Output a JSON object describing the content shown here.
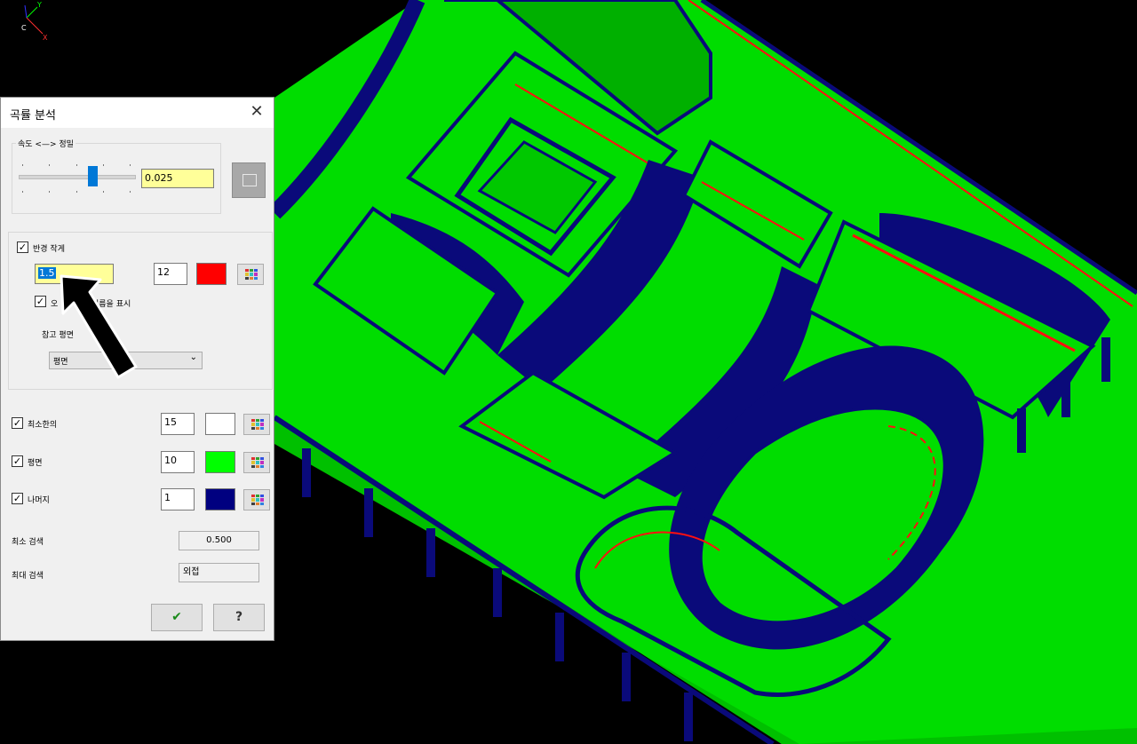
{
  "dialog": {
    "title": "곡률 분석",
    "close_glyph": "✕",
    "slider_group": {
      "legend": "속도 <—> 정밀",
      "value": "0.025",
      "position": 0.6
    },
    "radius_section": {
      "checkbox_label": "반경 작게",
      "checked": true,
      "radius_value": "1.5",
      "count_value": "12",
      "color": "#ff0000",
      "sub_checkbox_label_visible_start": "오",
      "sub_checkbox_label_visible_end": "지름을 표시",
      "ref_plane_label": "참고 평면",
      "ref_plane_selected": "평면"
    },
    "rows": [
      {
        "label": "최소한의",
        "value": "15",
        "color": "#ffffff"
      },
      {
        "label": "평면",
        "value": "10",
        "color": "#00ff00"
      },
      {
        "label": "나머지",
        "value": "1",
        "color": "#000080"
      }
    ],
    "min_search": {
      "label": "최소 검색",
      "value": "0.500"
    },
    "max_search": {
      "label": "최대 검색",
      "value": "외접"
    },
    "ok_glyph": "✔",
    "help_glyph": "?"
  },
  "axis": {
    "y": "Y",
    "x": "X",
    "c": "C"
  },
  "colors": {
    "green": "#00dd00",
    "navy": "#0a0a7a",
    "red": "#ff1010"
  }
}
